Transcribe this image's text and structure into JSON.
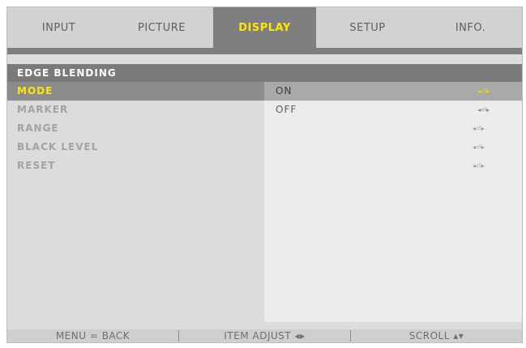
{
  "tabs": [
    {
      "label": "INPUT"
    },
    {
      "label": "PICTURE"
    },
    {
      "label": "DISPLAY"
    },
    {
      "label": "SETUP"
    },
    {
      "label": "INFO."
    }
  ],
  "section": {
    "title": "EDGE BLENDING"
  },
  "left_items": [
    {
      "label": "MODE"
    },
    {
      "label": "MARKER"
    },
    {
      "label": "RANGE"
    },
    {
      "label": "BLACK LEVEL"
    },
    {
      "label": "RESET"
    }
  ],
  "right_items": [
    {
      "label": "ON",
      "icon": "◂⏎▸"
    },
    {
      "label": "OFF",
      "icon": "◂⏎▸"
    }
  ],
  "row_icons": [
    "◂⏎▸",
    "◂⏎▸",
    "◂⏎▸"
  ],
  "footer": {
    "back": "MENU = BACK",
    "adjust": "ITEM ADJUST ◂▸",
    "scroll": "SCROLL ▴▾"
  },
  "colors": {
    "highlight": "#ffe600",
    "panel": "#ececec",
    "header": "#7a7a7a"
  }
}
